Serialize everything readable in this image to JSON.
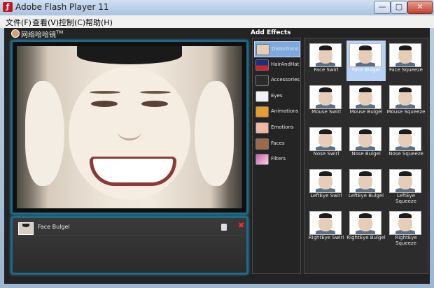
{
  "window": {
    "title": "Adobe Flash Player 11",
    "controls": [
      "—",
      "▢",
      "✕"
    ]
  },
  "menu": [
    "文件(F)",
    "查看(V)",
    "控制(C)",
    "帮助(H)"
  ],
  "app": {
    "logo_text": "网络哈哈镜",
    "logo_tm": "TM",
    "add_effects_label": "Add Effects"
  },
  "timeline": {
    "items": [
      {
        "label": "Face Bulgel"
      }
    ]
  },
  "categories": [
    {
      "label": "Distortions",
      "icon": "face-thumb-icon",
      "active": true
    },
    {
      "label": "HairAndHat",
      "icon": "hat-icon",
      "active": false
    },
    {
      "label": "Accessories",
      "icon": "mustache-icon",
      "active": false
    },
    {
      "label": "Eyes",
      "icon": "glasses-icon",
      "active": false
    },
    {
      "label": "Animations",
      "icon": "butterfly-icon",
      "active": false
    },
    {
      "label": "Emotions",
      "icon": "emotion-face-icon",
      "active": false
    },
    {
      "label": "Faces",
      "icon": "faces-icon",
      "active": false
    },
    {
      "label": "Filters",
      "icon": "filter-icon",
      "active": false
    }
  ],
  "effects": [
    {
      "label": "Face Swirl",
      "selected": false
    },
    {
      "label": "Face Bulgel",
      "selected": true
    },
    {
      "label": "Face Squeeze",
      "selected": false
    },
    {
      "label": "Mouse Swirl",
      "selected": false
    },
    {
      "label": "Mouse Bulgel",
      "selected": false
    },
    {
      "label": "Mouse Squeeze",
      "selected": false
    },
    {
      "label": "Nose Swirl",
      "selected": false
    },
    {
      "label": "Nose Bulgel",
      "selected": false
    },
    {
      "label": "Nose Squeeze",
      "selected": false
    },
    {
      "label": "LeftEye Swirl",
      "selected": false
    },
    {
      "label": "LeftEye Bulgel",
      "selected": false
    },
    {
      "label": "LeftEye Squeeze",
      "selected": false
    },
    {
      "label": "RightEye Swirl",
      "selected": false
    },
    {
      "label": "RightEye Bulgel",
      "selected": false
    },
    {
      "label": "RightEye Squeeze",
      "selected": false
    }
  ],
  "colors": {
    "accent": "#7ea8e0",
    "frame_glow": "#2ac0f0",
    "delete": "#ff2a2a"
  }
}
